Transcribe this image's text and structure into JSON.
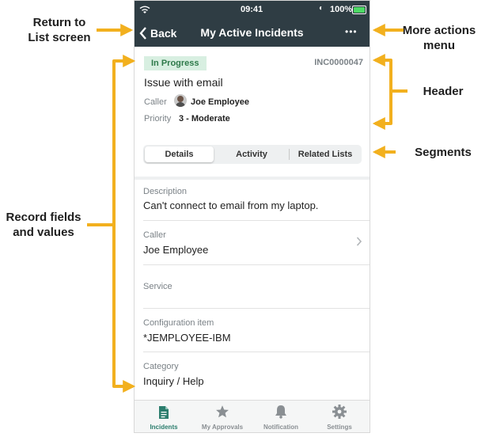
{
  "status_bar": {
    "time": "09:41",
    "battery": "100%"
  },
  "nav": {
    "back_label": "Back",
    "title": "My Active Incidents",
    "more_glyph": "•••"
  },
  "header": {
    "state_badge": "In Progress",
    "number": "INC0000047",
    "short_description": "Issue with email",
    "caller_label": "Caller",
    "caller_value": "Joe Employee",
    "priority_label": "Priority",
    "priority_value": "3 - Moderate"
  },
  "segments": {
    "items": [
      "Details",
      "Activity",
      "Related Lists"
    ],
    "selected": "Details"
  },
  "fields": [
    {
      "label": "Description",
      "value": "Can't connect to email from my laptop."
    },
    {
      "label": "Caller",
      "value": "Joe Employee"
    },
    {
      "label": "Service",
      "value": ""
    },
    {
      "label": "Configuration item",
      "value": "*JEMPLOYEE-IBM"
    },
    {
      "label": "Category",
      "value": "Inquiry / Help"
    }
  ],
  "tabs": [
    {
      "label": "Incidents",
      "icon": "document-icon",
      "active": true
    },
    {
      "label": "My Approvals",
      "icon": "star-icon",
      "active": false
    },
    {
      "label": "Notification",
      "icon": "bell-icon",
      "active": false
    },
    {
      "label": "Settings",
      "icon": "gear-icon",
      "active": false
    }
  ],
  "callouts": {
    "return_line1": "Return to",
    "return_line2": "List screen",
    "more_line1": "More actions",
    "more_line2": "menu",
    "header": "Header",
    "segments": "Segments",
    "record_line1": "Record fields",
    "record_line2": "and values"
  },
  "colors": {
    "nav_bg": "#2f3d44",
    "badge_bg": "#d8efe1",
    "active_tab": "#2b7d6d",
    "callout_arrow": "#f2b01e"
  }
}
